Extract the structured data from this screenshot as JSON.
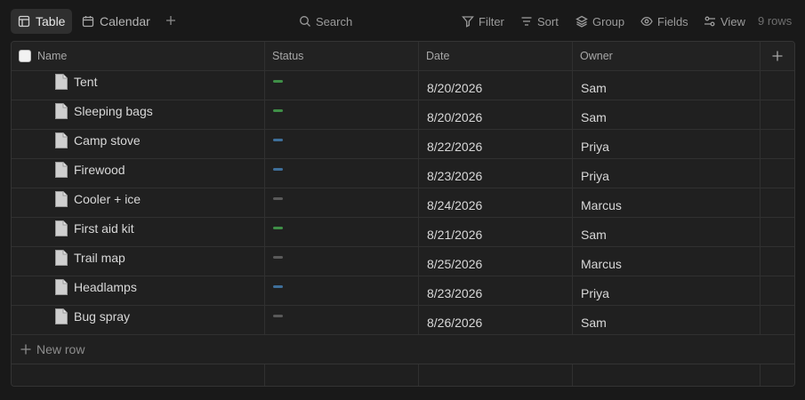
{
  "toolbar": {
    "tabs": [
      {
        "label": "Table",
        "icon": "table-icon",
        "active": true
      },
      {
        "label": "Calendar",
        "icon": "calendar-icon",
        "active": false
      }
    ],
    "search_label": "Search",
    "filter_label": "Filter",
    "sort_label": "Sort",
    "group_label": "Group",
    "fields_label": "Fields",
    "view_label": "View",
    "rows_count": "9 rows"
  },
  "table": {
    "columns": {
      "name": "Name",
      "status": "Status",
      "date": "Date",
      "owner": "Owner"
    },
    "status_colors": {
      "done": "#3f8f47",
      "in_progress": "#3e6f9a",
      "not_started": "#5a5a5a"
    },
    "rows": [
      {
        "name": "Tent",
        "status": "done",
        "date": "8/20/2026",
        "owner": "Sam"
      },
      {
        "name": "Sleeping bags",
        "status": "done",
        "date": "8/20/2026",
        "owner": "Sam"
      },
      {
        "name": "Camp stove",
        "status": "in_progress",
        "date": "8/22/2026",
        "owner": "Priya"
      },
      {
        "name": "Firewood",
        "status": "in_progress",
        "date": "8/23/2026",
        "owner": "Priya"
      },
      {
        "name": "Cooler + ice",
        "status": "not_started",
        "date": "8/24/2026",
        "owner": "Marcus"
      },
      {
        "name": "First aid kit",
        "status": "done",
        "date": "8/21/2026",
        "owner": "Sam"
      },
      {
        "name": "Trail map",
        "status": "not_started",
        "date": "8/25/2026",
        "owner": "Marcus"
      },
      {
        "name": "Headlamps",
        "status": "in_progress",
        "date": "8/23/2026",
        "owner": "Priya"
      },
      {
        "name": "Bug spray",
        "status": "not_started",
        "date": "8/26/2026",
        "owner": "Sam"
      }
    ],
    "new_row_label": "New row"
  }
}
